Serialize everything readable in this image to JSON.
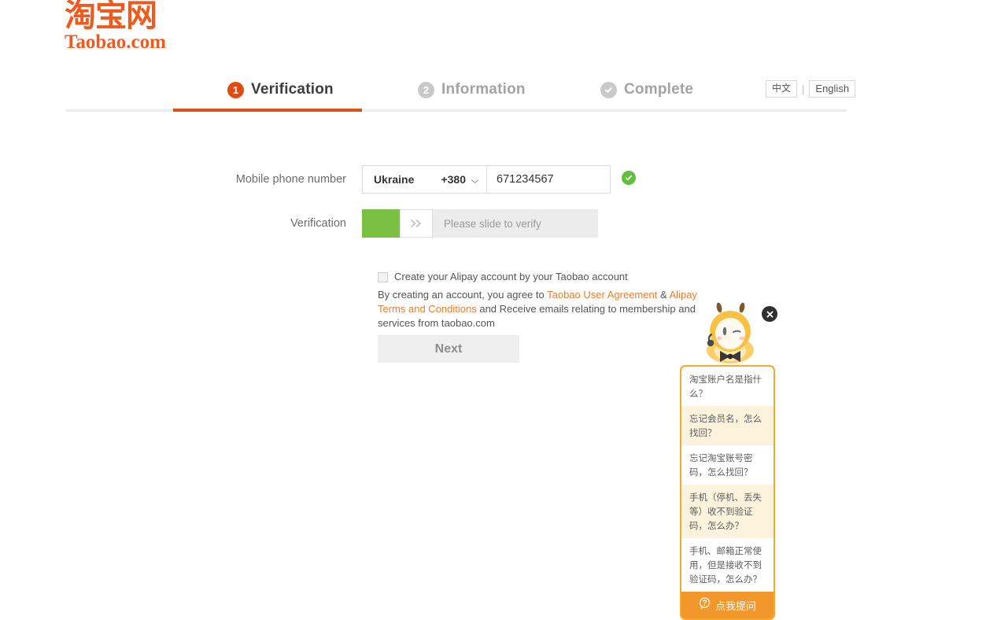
{
  "logo": {
    "chinese": "淘宝网",
    "english": "Taobao.com"
  },
  "steps": [
    {
      "badge": "1",
      "label": "Verification",
      "state": "active",
      "icon": "number-badge"
    },
    {
      "badge": "2",
      "label": "Information",
      "state": "idle",
      "icon": "number-badge"
    },
    {
      "badge": "",
      "label": "Complete",
      "state": "idle",
      "icon": "check-circle-icon"
    }
  ],
  "language": {
    "chinese_label": "中文",
    "separator": "|",
    "english_label": "English"
  },
  "form": {
    "phone_label": "Mobile phone number",
    "country_name": "Ukraine",
    "country_code": "+380",
    "phone_value": "671234567",
    "phone_placeholder": "",
    "validation_state": "valid",
    "verification_label": "Verification",
    "slider_text": "Please slide to verify"
  },
  "agreement": {
    "checkbox_checked": false,
    "checkbox_label": "Create your Alipay account by your Taobao account",
    "terms_prefix": "By creating an account, you agree to ",
    "link_taobao": "Taobao User Agreement",
    "terms_amp": " & ",
    "link_alipay": "Alipay Terms and Conditions",
    "terms_suffix": " and Receive emails relating to membership and services from taobao.com"
  },
  "next_button": {
    "label": "Next"
  },
  "helper": {
    "close_label": "×",
    "faq_items": [
      "淘宝账户名是指什么？",
      "忘记会员名，怎么找回？",
      "忘记淘宝账号密码，怎么找回？",
      "手机（停机、丢失等）收不到验证码，怎么办？",
      "手机、邮箱正常使用，但是接收不到验证码，怎么办？"
    ],
    "footer_label": "点我提问"
  },
  "colors": {
    "brand_orange": "#ef5b1f",
    "step_active": "#e24b10",
    "rule_active": "#d4551b",
    "link_orange": "#f07b2a",
    "valid_green": "#60bf3e",
    "slider_green": "#7ac143",
    "helper_orange": "#f3a830",
    "faq_footer": "#f2972c",
    "faq_alt_bg": "#fdf3dc"
  }
}
